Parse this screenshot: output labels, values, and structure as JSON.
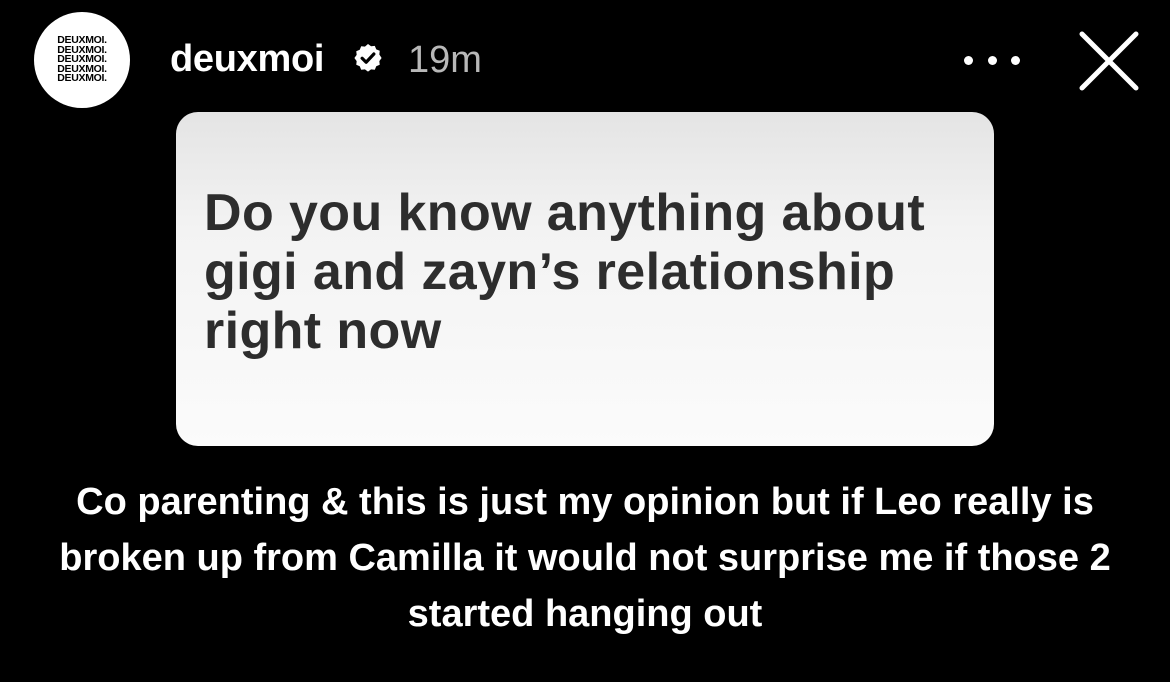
{
  "header": {
    "avatar_lines": [
      "DEUXMOI.",
      "DEUXMOI.",
      "DEUXMOI.",
      "DEUXMOI.",
      "DEUXMOI."
    ],
    "username": "deuxmoi",
    "time_ago": "19m",
    "icons": {
      "verified": "verified-badge-icon",
      "more": "more-options-icon",
      "close": "close-icon"
    }
  },
  "story": {
    "question": "Do you know anything about gigi and zayn’s relationship right now",
    "answer": "Co parenting & this is just my opinion but if Leo really is broken up from Camilla it would not surprise me if those 2 started hanging out"
  },
  "colors": {
    "background": "#000000",
    "card": "#f5f5f5",
    "question_text": "#2d2d2d",
    "answer_text": "#ffffff",
    "time_text": "#b8b8b8"
  }
}
